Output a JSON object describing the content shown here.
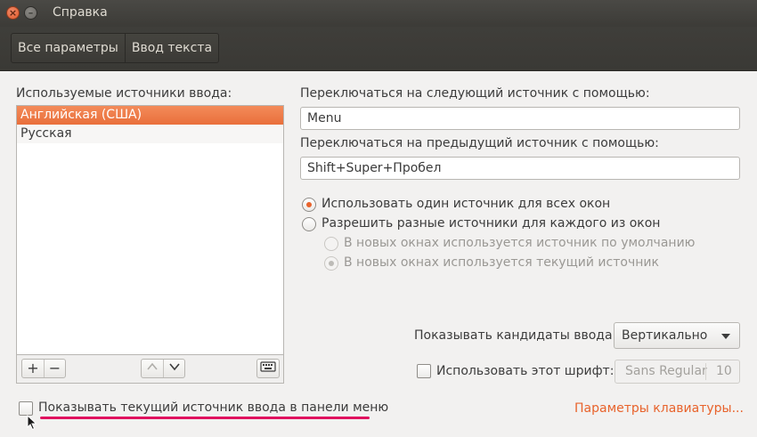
{
  "window": {
    "title": "Справка"
  },
  "breadcrumbs": [
    "Все параметры",
    "Ввод текста"
  ],
  "sources": {
    "label": "Используемые источники ввода:",
    "items": [
      "Английская (США)",
      "Русская"
    ],
    "buttons": {
      "add": "+",
      "remove": "−",
      "up": "⌃",
      "down": "⌄",
      "keyboard": "⌨"
    }
  },
  "switching": {
    "next_label": "Переключаться на следующий источник с помощью:",
    "next_value": "Menu",
    "prev_label": "Переключаться на предыдущий источник с помощью:",
    "prev_value": "Shift+Super+Пробел"
  },
  "mode": {
    "same_for_all": "Использовать один источник для всех окон",
    "per_window": "Разрешить разные источники для каждого из окон",
    "default_for_new": "В новых окнах используется источник по умолчанию",
    "current_for_new": "В новых окнах используется текущий источник"
  },
  "candidates": {
    "label": "Показывать кандидаты ввода:",
    "value": "Вертикально"
  },
  "font": {
    "label": "Использовать этот шрифт:",
    "name": "Sans Regular",
    "size": "10"
  },
  "show_indicator": "Показывать текущий источник ввода в панели меню",
  "keyboard_settings_link": "Параметры клавиатуры...",
  "colors": {
    "accent": "#e8632c",
    "highlight_underline": "#e0115f"
  }
}
